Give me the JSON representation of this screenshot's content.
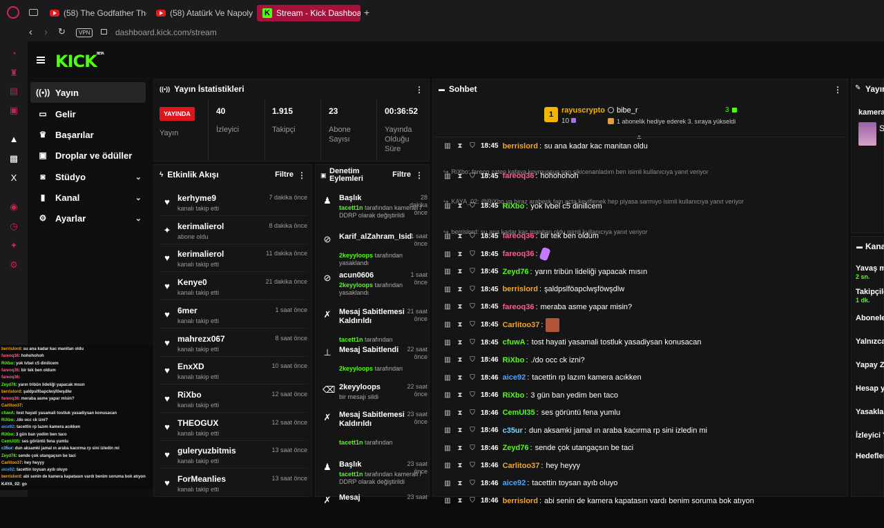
{
  "browser": {
    "tabs": [
      {
        "label": "(58) The Godfather Theme"
      },
      {
        "label": "(58) Atatürk Ve Napolyon"
      },
      {
        "label": "Stream - Kick Dashboard"
      }
    ],
    "new_tab": "+",
    "vpn": "VPN",
    "url": "dashboard.kick.com/stream"
  },
  "logo": {
    "text": "KICK",
    "beta": "BETA"
  },
  "nav": {
    "items": [
      {
        "label": "Yayın",
        "icon": "broadcast-icon"
      },
      {
        "label": "Gelir",
        "icon": "money-icon"
      },
      {
        "label": "Başarılar",
        "icon": "trophy-icon"
      },
      {
        "label": "Droplar ve ödüller",
        "icon": "gift-icon"
      },
      {
        "label": "Stüdyo",
        "icon": "studio-icon"
      },
      {
        "label": "Kanal",
        "icon": "channel-icon"
      },
      {
        "label": "Ayarlar",
        "icon": "gear-icon"
      }
    ]
  },
  "stats": {
    "title": "Yayın İstatistikleri",
    "live_badge": "YAYINDA",
    "live_label": "Yayın",
    "viewers_value": "40",
    "viewers_label": "İzleyici",
    "followers_value": "1.915",
    "followers_label": "Takipçi",
    "subs_value": "23",
    "subs_label1": "Abone",
    "subs_label2": "Sayısı",
    "duration_value": "00:36:52",
    "duration_label1": "Yayında",
    "duration_label2": "Olduğu",
    "duration_label3": "Süre"
  },
  "activity": {
    "title": "Etkinlik Akışı",
    "filter": "Filtre",
    "items": [
      {
        "name": "kerhyme9",
        "sub": "kanalı takip etti",
        "time": "7 dakika önce",
        "icon": "heart-icon"
      },
      {
        "name": "kerimalierol",
        "sub": "abone oldu",
        "time": "8 dakika önce",
        "icon": "sparkle-icon"
      },
      {
        "name": "kerimalierol",
        "sub": "kanalı takip etti",
        "time": "11 dakika önce",
        "icon": "heart-icon"
      },
      {
        "name": "Kenye0",
        "sub": "kanalı takip etti",
        "time": "21 dakika önce",
        "icon": "heart-icon"
      },
      {
        "name": "6mer",
        "sub": "kanalı takip etti",
        "time": "1 saat önce",
        "icon": "heart-icon"
      },
      {
        "name": "mahrezx067",
        "sub": "kanalı takip etti",
        "time": "8 saat önce",
        "icon": "heart-icon"
      },
      {
        "name": "EnxXD",
        "sub": "kanalı takip etti",
        "time": "10 saat önce",
        "icon": "heart-icon"
      },
      {
        "name": "RiXbo",
        "sub": "kanalı takip etti",
        "time": "12 saat önce",
        "icon": "heart-icon"
      },
      {
        "name": "THEOGUX",
        "sub": "kanalı takip etti",
        "time": "12 saat önce",
        "icon": "heart-icon"
      },
      {
        "name": "guleryuzbitmis",
        "sub": "kanalı takip etti",
        "time": "13 saat önce",
        "icon": "heart-icon"
      },
      {
        "name": "ForMeanlies",
        "sub": "kanalı takip etti",
        "time": "13 saat önce",
        "icon": "heart-icon"
      }
    ]
  },
  "modlog": {
    "title1": "Denetim",
    "title2": "Eylemleri",
    "filter": "Filtre",
    "items": [
      {
        "title": "Başlık",
        "actor": "tacett1n",
        "rest": " tarafından kameralı / DDRP olarak değiştirildi",
        "time": "28 dakika önce",
        "icon": "users-icon"
      },
      {
        "title": "Karif_alZahram_Isid",
        "actor": "2keyyloops",
        "rest": " tarafından yasaklandı",
        "time": "1 saat önce",
        "icon": "ban-icon"
      },
      {
        "title": "acun0606",
        "actor": "2keyyloops",
        "rest": " tarafından yasaklandı",
        "time": "1 saat önce",
        "icon": "ban-icon"
      },
      {
        "title": "Mesaj Sabitlemesi Kaldırıldı",
        "actor": "tacett1n",
        "rest": " tarafından",
        "time": "21 saat önce",
        "icon": "unpin-icon"
      },
      {
        "title": "Mesaj Sabitlendi",
        "actor": "2keyyloops",
        "rest": " tarafından",
        "time": "22 saat önce",
        "icon": "pin-icon"
      },
      {
        "title": "2keyyloops",
        "actor": "",
        "rest": "bir mesajı sildi",
        "time": "22 saat önce",
        "icon": "trash-icon"
      },
      {
        "title": "Mesaj Sabitlemesi Kaldırıldı",
        "actor": "tacett1n",
        "rest": " tarafından",
        "time": "23 saat önce",
        "icon": "unpin-icon"
      },
      {
        "title": "Başlık",
        "actor": "tacett1n",
        "rest": " tarafından kameralı / DDRP olarak değiştirildi",
        "time": "23 saat önce",
        "icon": "users-icon"
      },
      {
        "title": "Mesaj",
        "actor": "",
        "rest": "",
        "time": "23 saat",
        "icon": "unpin-icon"
      }
    ]
  },
  "chat": {
    "title": "Sohbet",
    "gifter": {
      "rank": "1",
      "name": "rayuscrypto",
      "count": "10",
      "user2": "bibe_r",
      "count2": "3",
      "text": "1 abonelik hediye ederek 3. sıraya yükseldi"
    },
    "messages": [
      {
        "time": "18:45",
        "user": "berrislord",
        "color": "#f5a623",
        "text": "su ana kadar kac manitan oldu"
      },
      {
        "reply": "RiXbo: fareoq zaten kafaya koymussun sen sikicenanladım ben isimli kullanıcıya yanıt veriyor"
      },
      {
        "time": "18:45",
        "user": "fareoq36",
        "color": "#ff5c8a",
        "text": "hohohohoh"
      },
      {
        "reply": "KAYA_02: @RiXbo ya biraz arabesk fain açta keyiflenek hep piyasa sarmıyo isimli kullanıcıya yanıt veriyor"
      },
      {
        "time": "18:45",
        "user": "RiXbo",
        "color": "#53fc18",
        "text": "yok lvbel c5 dinilicem"
      },
      {
        "reply": "berrislord: su ana kadar kac manitan oldu isimli kullanıcıya yanıt veriyor"
      },
      {
        "time": "18:45",
        "user": "fareoq36",
        "color": "#ff5c8a",
        "text": "bir tek ben oldum"
      },
      {
        "time": "18:45",
        "user": "fareoq36",
        "color": "#ff5c8a",
        "text": "",
        "emote": "purple"
      },
      {
        "time": "18:45",
        "user": "Zeyd76",
        "color": "#53fc18",
        "text": "yarın tribün lideliği yapacak mısın"
      },
      {
        "time": "18:45",
        "user": "berrislord",
        "color": "#f5a623",
        "text": "şaldpslföapclwşföwşdlw"
      },
      {
        "time": "18:45",
        "user": "fareoq36",
        "color": "#ff5c8a",
        "text": "meraba asme yapar misin?"
      },
      {
        "time": "18:45",
        "user": "Carlitoo37",
        "color": "#f5a623",
        "text": "",
        "emote": "face"
      },
      {
        "time": "18:45",
        "user": "cfuwA",
        "color": "#53fc18",
        "text": "tost hayati yasamali tostluk yasadiysan konusacan"
      },
      {
        "time": "18:46",
        "user": "RiXbo",
        "color": "#53fc18",
        "text": "./do occ ck izni?"
      },
      {
        "time": "18:46",
        "user": "aice92",
        "color": "#4aa3ff",
        "text": "tacettin rp lazım kamera acıkken"
      },
      {
        "time": "18:46",
        "user": "RiXbo",
        "color": "#53fc18",
        "text": "3 gün ban yedim ben taco"
      },
      {
        "time": "18:46",
        "user": "CemUI35",
        "color": "#53fc18",
        "text": "ses görüntü fena yumlu"
      },
      {
        "time": "18:46",
        "user": "c35ur",
        "color": "#7fd0ff",
        "text": "dun aksamki jamal ın araba kacırma rp sini izledin mi"
      },
      {
        "time": "18:46",
        "user": "Zeyd76",
        "color": "#53fc18",
        "text": "sende çok utangaçsın be taci"
      },
      {
        "time": "18:46",
        "user": "Carlitoo37",
        "color": "#f5a623",
        "text": "hey heyyy"
      },
      {
        "time": "18:46",
        "user": "aice92",
        "color": "#4aa3ff",
        "text": "tacettin toysan ayıb oluyo"
      },
      {
        "time": "18:46",
        "user": "berrislord",
        "color": "#f5a623",
        "text": "abi senin de kamera kapatasın vardı benim soruma bok atıyon"
      }
    ]
  },
  "right_panel": {
    "title": "Yayın",
    "top_user": "kamerah",
    "avatar_letter": "S",
    "section": "Kanal",
    "rows": [
      {
        "label": "Yavaş m",
        "value": "2 sn."
      },
      {
        "label": "Takipçile",
        "value": "1 dk."
      },
      {
        "label": "Aboneler",
        "value": ""
      },
      {
        "label": "Yalnızca",
        "value": ""
      },
      {
        "label": "Yapay Ze",
        "value": ""
      },
      {
        "label": "Hesap ya",
        "value": ""
      },
      {
        "label": "Yasaklan",
        "value": ""
      },
      {
        "label": "İzleyici Y",
        "value": ""
      },
      {
        "label": "Hedefler",
        "value": ""
      }
    ]
  },
  "overlay_chat": [
    {
      "u": "berrislord",
      "c": "#f5a623",
      "t": ": su ana kadar kac manitan oldu"
    },
    {
      "u": "fareoq36",
      "c": "#ff5c8a",
      "t": ": hohohohoh"
    },
    {
      "u": "RiXbo",
      "c": "#53fc18",
      "t": ": yok lvbel c5 dinilicem"
    },
    {
      "u": "fareoq36",
      "c": "#ff5c8a",
      "t": ": bir tek ben oldum"
    },
    {
      "u": "fareoq36",
      "c": "#ff5c8a",
      "t": ":"
    },
    {
      "u": "Zeyd76",
      "c": "#53fc18",
      "t": ": yarın tribün lideliği yapacak mısın"
    },
    {
      "u": "berrislord",
      "c": "#f5a623",
      "t": ": şaldpslföapclwşföwşdlw"
    },
    {
      "u": "fareoq36",
      "c": "#ff5c8a",
      "t": ": meraba asme yapar misin?"
    },
    {
      "u": "Carlitoo37",
      "c": "#f5a623",
      "t": ":"
    },
    {
      "u": "cfuwA",
      "c": "#53fc18",
      "t": ": tost hayati yasamali tostluk yasadiysan konusacan"
    },
    {
      "u": "RiXbo",
      "c": "#53fc18",
      "t": ": ./do occ ck izni?"
    },
    {
      "u": "aice92",
      "c": "#4aa3ff",
      "t": ": tacettin rp lazım kamera acıkken"
    },
    {
      "u": "RiXbo",
      "c": "#53fc18",
      "t": ": 3 gün ban yedim ben taco"
    },
    {
      "u": "CemUI35",
      "c": "#53fc18",
      "t": ": ses görüntü fena yumlu"
    },
    {
      "u": "c35ur",
      "c": "#7fd0ff",
      "t": ": dun aksamki jamal ın araba kacırma rp sini izledin mi"
    },
    {
      "u": "Zeyd76",
      "c": "#53fc18",
      "t": ": sende çok utangaçsın be taci"
    },
    {
      "u": "Carlitoo37",
      "c": "#f5a623",
      "t": ": hey heyyy"
    },
    {
      "u": "aice92",
      "c": "#4aa3ff",
      "t": ": tacettin toysan ayıb oluyo"
    },
    {
      "u": "berrislord",
      "c": "#f5a623",
      "t": ": abi senin de kamera kapatasın vardı benim soruma bok atıyon"
    },
    {
      "u": "KAYA_02",
      "c": "#ffffff",
      "t": ": go"
    }
  ]
}
